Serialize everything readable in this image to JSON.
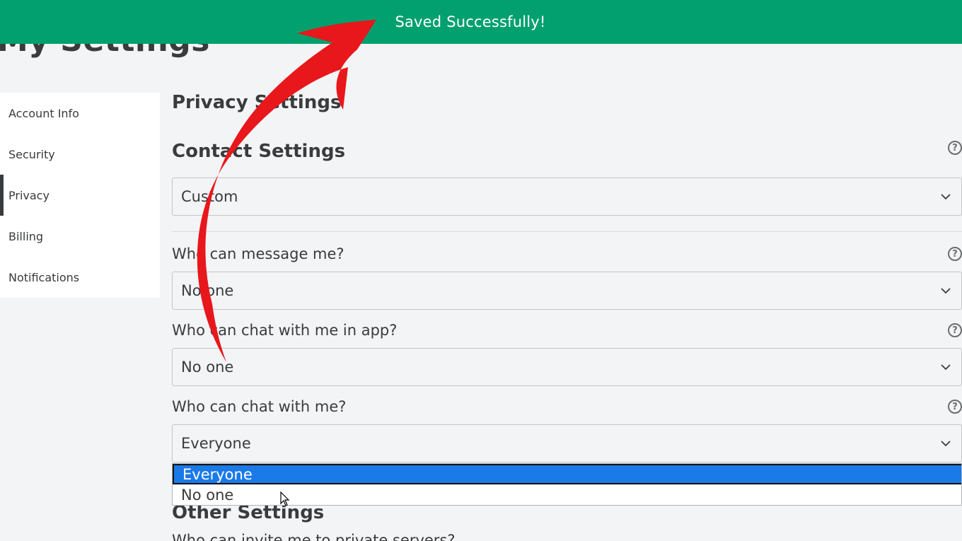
{
  "page": {
    "heading": "My Settings"
  },
  "toast": {
    "text": "Saved Successfully!",
    "color": "#02a06e"
  },
  "sidebar": {
    "items": [
      {
        "label": "Account Info"
      },
      {
        "label": "Security"
      },
      {
        "label": "Privacy",
        "active": true
      },
      {
        "label": "Billing"
      },
      {
        "label": "Notifications"
      }
    ]
  },
  "privacy": {
    "title": "Privacy Settings",
    "contact": {
      "title": "Contact Settings",
      "value": "Custom"
    },
    "message": {
      "label": "Who can message me?",
      "value": "No one"
    },
    "chat_app": {
      "label": "Who can chat with me in app?",
      "value": "No one"
    },
    "chat": {
      "label": "Who can chat with me?",
      "value": "Everyone",
      "options": [
        "Everyone",
        "No one"
      ],
      "highlighted": "Everyone"
    },
    "other": {
      "title": "Other Settings",
      "partial_label": "Who can invite me to private servers?"
    }
  },
  "icons": {
    "help": "help-circle-icon",
    "chevron": "chevron-down-icon",
    "arrow": "red-curved-arrow-annotation",
    "cursor": "mouse-pointer-icon"
  },
  "colors": {
    "annotation_arrow": "#e8171b",
    "selection": "#1a7ae8"
  }
}
